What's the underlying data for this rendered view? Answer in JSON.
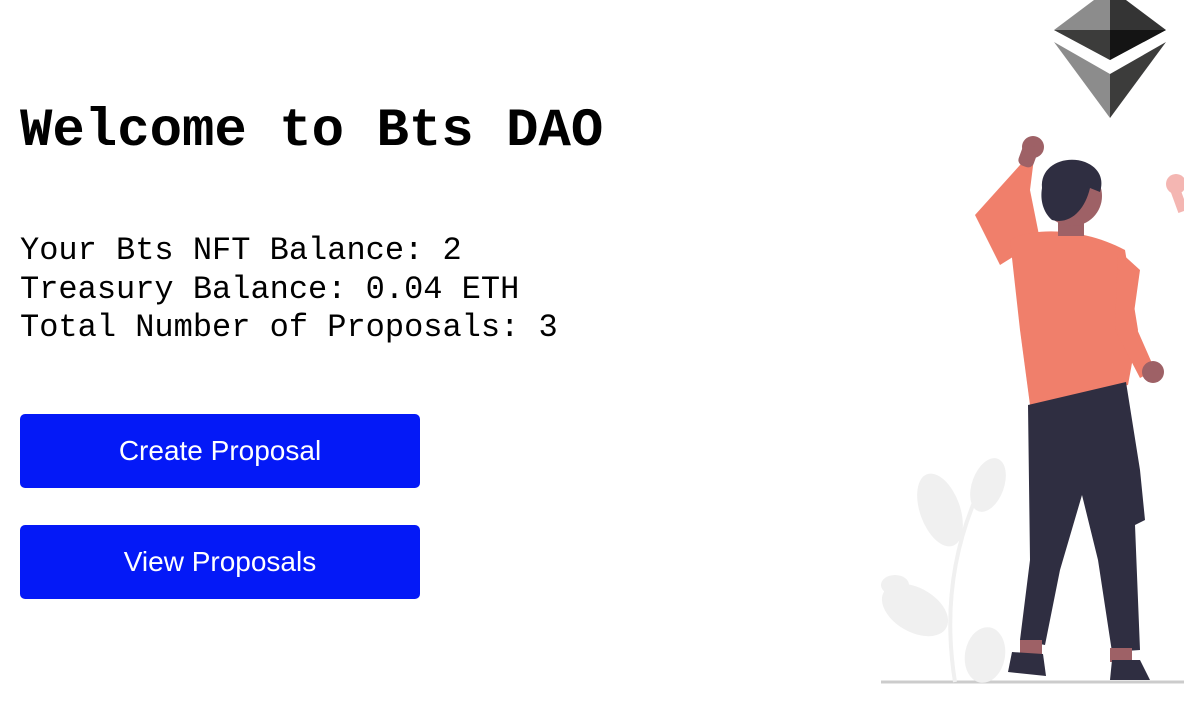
{
  "main": {
    "title": "Welcome to Bts DAO",
    "stats": {
      "nft_balance": "Your Bts NFT Balance: 2",
      "treasury_balance": "Treasury Balance: 0.04 ETH",
      "total_proposals": "Total Number of Proposals: 3"
    },
    "buttons": {
      "create_label": "Create Proposal",
      "view_label": "View Proposals"
    }
  },
  "colors": {
    "button_bg": "#0419f7",
    "shirt": "#f07f6b",
    "pants": "#2f2e41",
    "skin": "#9e6166",
    "plant": "#f0f0f0",
    "eth_dark": "#343434",
    "eth_light": "#8c8c8c"
  },
  "icons": {
    "ethereum": "ethereum-logo-icon",
    "person": "person-illustration",
    "plant": "plant-illustration"
  }
}
